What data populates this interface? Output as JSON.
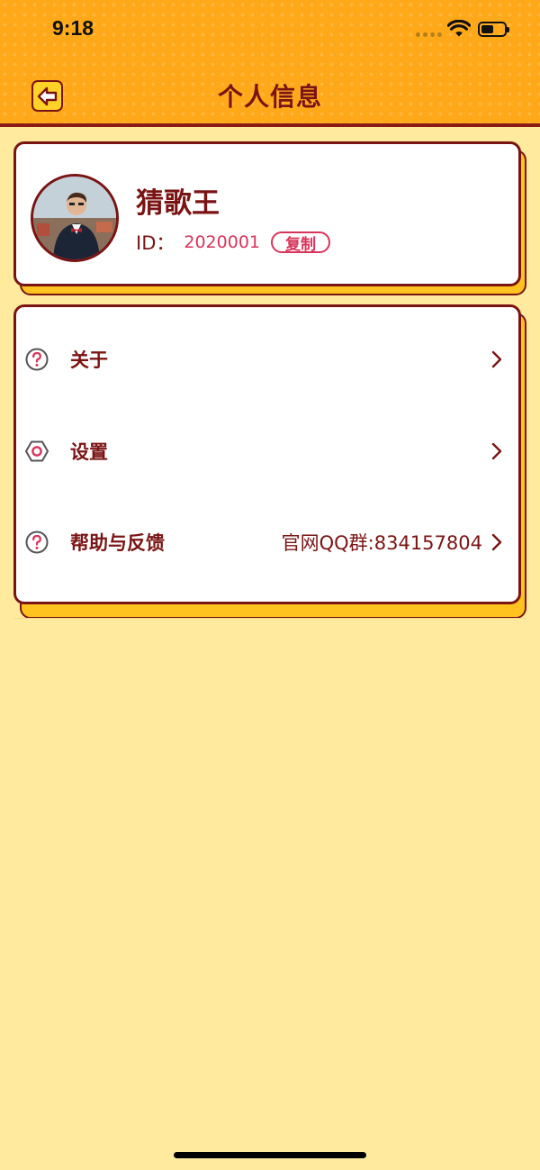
{
  "status_bar": {
    "time": "9:18",
    "icons": [
      "signal-dots-icon",
      "wifi-icon",
      "battery-icon"
    ]
  },
  "header": {
    "title": "个人信息",
    "back_icon": "arrow-left-icon"
  },
  "profile": {
    "username": "猜歌王",
    "id_label": "ID：",
    "id_value": "2020001",
    "copy_label": "复制",
    "avatar_icon": "avatar-photo"
  },
  "menu": {
    "items": [
      {
        "label": "关于",
        "icon": "question-circle-icon",
        "extra": ""
      },
      {
        "label": "设置",
        "icon": "hexagon-nut-icon",
        "extra": ""
      },
      {
        "label": "帮助与反馈",
        "icon": "question-circle-icon",
        "extra": "官网QQ群:834157804"
      }
    ]
  },
  "colors": {
    "header_bg": "#FFA91A",
    "page_bg": "#FFEA9E",
    "accent_dark": "#7A1414",
    "accent_pink": "#D8345B",
    "card_shadow": "#FFC21E"
  }
}
